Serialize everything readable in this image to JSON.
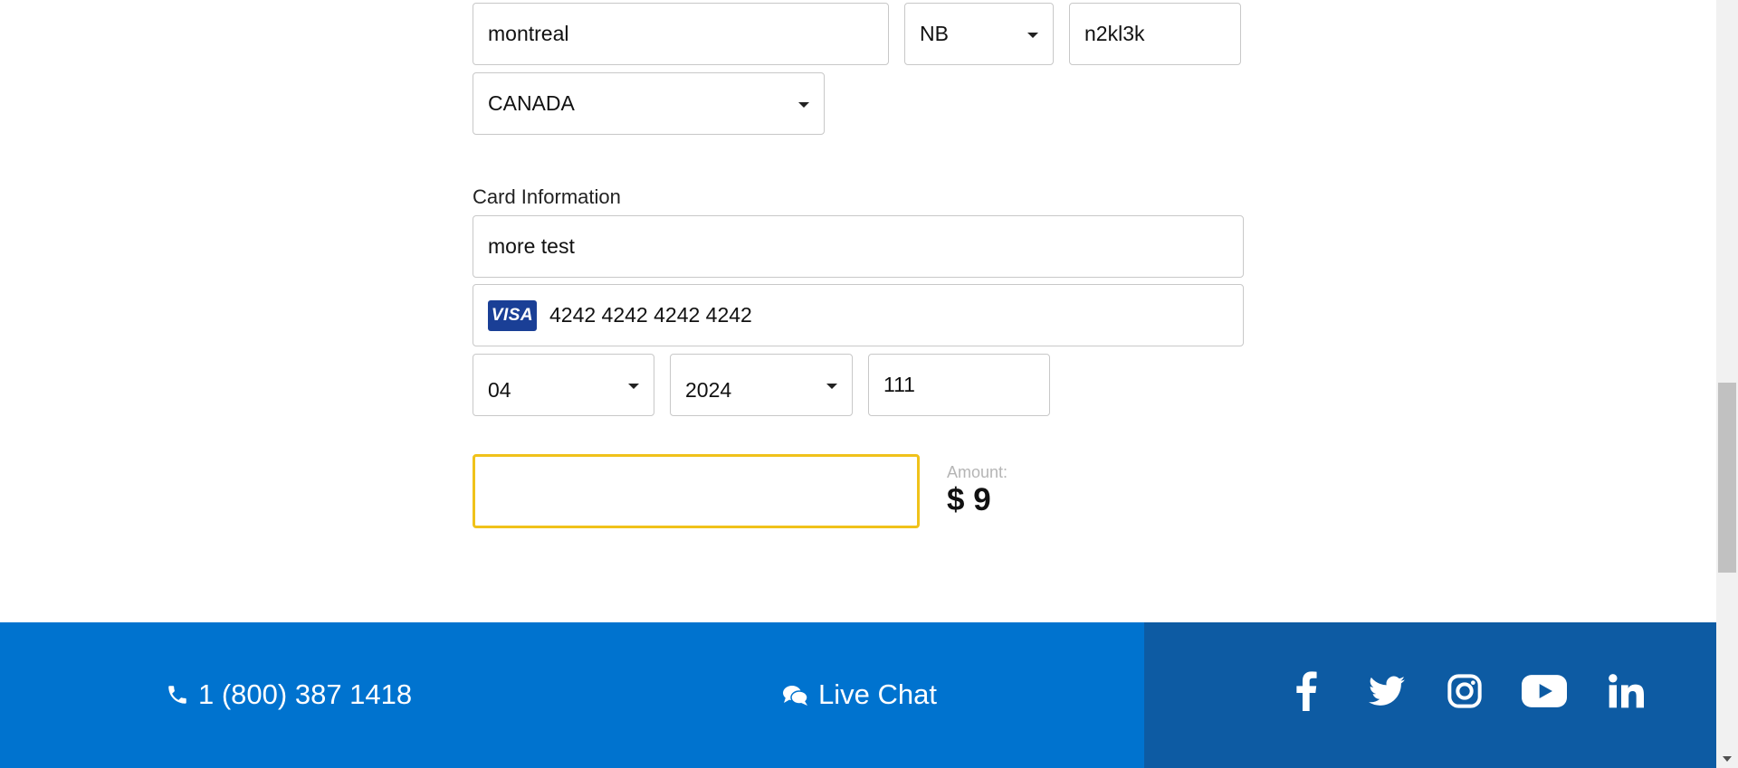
{
  "address": {
    "city": "montreal",
    "province": "NB",
    "postal_code": "n2kl3k",
    "country": "CANADA"
  },
  "card": {
    "section_label": "Card Information",
    "name": "more test",
    "brand_text": "VISA",
    "number": "4242 4242 4242 4242",
    "exp_month": "04",
    "exp_year": "2024",
    "cvc": "111"
  },
  "payment": {
    "amount_label": "Amount:",
    "amount_value": "$ 9"
  },
  "footer": {
    "phone": "1 (800) 387 1418",
    "live_chat": "Live Chat",
    "social": [
      "facebook",
      "twitter",
      "instagram",
      "youtube",
      "linkedin"
    ],
    "colors": {
      "primary": "#0073cf",
      "secondary": "#0d5ba3"
    }
  },
  "accent_color": "#f0c21a"
}
